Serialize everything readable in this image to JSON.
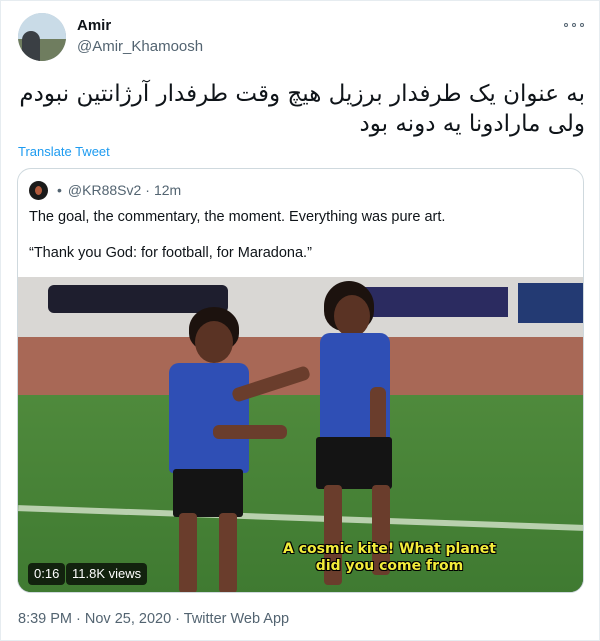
{
  "tweet": {
    "user": {
      "name": "Amir",
      "handle": "@Amir_Khamoosh"
    },
    "text_line1": "به عنوان یک طرفدار برزیل هیچ وقت طرفدار آرژانتین نبودم",
    "text_line2": "ولی مارادونا یه دونه بود",
    "translate_label": "Translate Tweet",
    "quote": {
      "dot": "•",
      "handle": "@KR88Sv2",
      "separator": "·",
      "time": "12m",
      "text_line1": "The goal, the commentary, the moment. Everything was pure art.",
      "text_line2": "“Thank you God: for football, for Maradona.”",
      "video": {
        "caption_line1": "A cosmic kite! What planet",
        "caption_line2": "did you come from",
        "duration": "0:16",
        "views": "11.8K views"
      }
    },
    "footer": "8:39 PM · Nov 25, 2020 · Twitter Web App"
  },
  "colors": {
    "text": "#0f1419",
    "secondary": "#536471",
    "link": "#1d9bf0",
    "caption": "#f2ec3a",
    "jersey": "#2f4fb5"
  },
  "icons": {
    "more": "more-icon",
    "avatar": "avatar"
  }
}
